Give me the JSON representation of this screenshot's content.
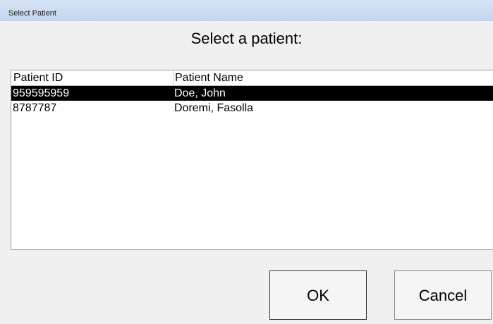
{
  "window": {
    "title": "Select Patient"
  },
  "prompt": "Select a patient:",
  "table": {
    "columns": [
      "Patient ID",
      "Patient Name"
    ],
    "rows": [
      {
        "id": "959595959",
        "name": "Doe, John",
        "selected": true
      },
      {
        "id": "8787787",
        "name": "Doremi, Fasolla",
        "selected": false
      }
    ]
  },
  "buttons": {
    "ok": "OK",
    "cancel": "Cancel"
  },
  "colors": {
    "selection_bg": "#000000",
    "selection_fg": "#ffffff",
    "titlebar": "#c9daf1"
  }
}
